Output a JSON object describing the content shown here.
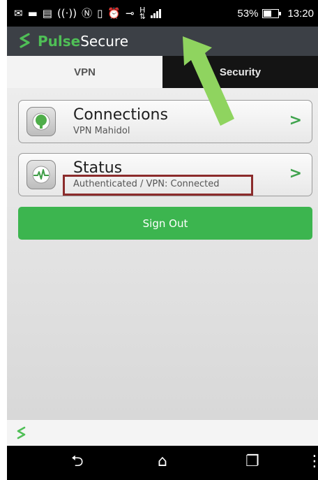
{
  "status_bar": {
    "icons": [
      "gmail-icon",
      "notification-icon",
      "keyboard-icon",
      "wifi-calling-icon",
      "nfc-icon",
      "vibrate-icon",
      "alarm-icon",
      "vpn-key-icon",
      "data-transfer-icon",
      "signal-icon"
    ],
    "battery_percent": "53%",
    "battery_level": 0.53,
    "time": "13:20",
    "network_type": "H"
  },
  "app": {
    "brand_pulse": "Pulse",
    "brand_secure": "Secure",
    "brand_color": "#4fbf56"
  },
  "tabs": [
    {
      "label": "VPN",
      "selected": true
    },
    {
      "label": "Security",
      "selected": false
    }
  ],
  "cards": {
    "connections": {
      "title": "Connections",
      "subtitle": "VPN Mahidol",
      "chevron": ">"
    },
    "status": {
      "title": "Status",
      "subtitle": "Authenticated / VPN: Connected",
      "chevron": ">"
    }
  },
  "sign_out_label": "Sign Out",
  "colors": {
    "accent": "#3cb54f",
    "highlight_box": "#8b2b2b",
    "annotation_arrow": "#8fd45f"
  }
}
